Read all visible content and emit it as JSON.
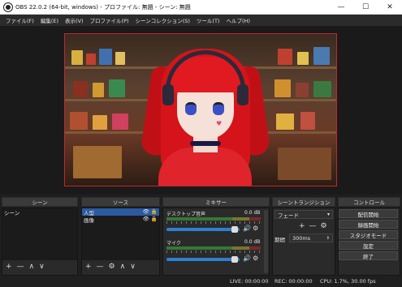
{
  "window": {
    "title": "OBS 22.0.2 (64-bit, windows) - プロファイル: 無題 - シーン: 無題",
    "minimize": "—",
    "maximize": "☐",
    "close": "✕"
  },
  "menu": [
    "ファイル(F)",
    "編集(E)",
    "表示(V)",
    "プロファイル(P)",
    "シーンコレクション(S)",
    "ツール(T)",
    "ヘルプ(H)"
  ],
  "docks": {
    "scenes": {
      "title": "シーン",
      "items": [
        "シーン"
      ],
      "toolbar": [
        "+",
        "—",
        "∧",
        "∨"
      ]
    },
    "sources": {
      "title": "ソース",
      "items": [
        {
          "label": "人型",
          "selected": true
        },
        {
          "label": "画像",
          "selected": false
        }
      ],
      "toolbar": [
        "+",
        "—",
        "⚙",
        "∧",
        "∨"
      ]
    },
    "mixer": {
      "title": "ミキサー",
      "tracks": [
        {
          "name": "デスクトップ音声",
          "db": "0.0 dB",
          "volume": 0.93
        },
        {
          "name": "マイク",
          "db": "0.0 dB",
          "volume": 0.93
        }
      ]
    },
    "transitions": {
      "title": "シーントランジション",
      "selected": "フェード",
      "duration_label": "期間",
      "duration_value": "300ms"
    },
    "controls": {
      "title": "コントロール",
      "buttons": [
        "配信開始",
        "録画開始",
        "スタジオモード",
        "設定",
        "終了"
      ]
    }
  },
  "status": {
    "live": "LIVE: 00:00:00",
    "rec": "REC: 00:00:00",
    "cpu": "CPU: 1.7%, 30.00 fps"
  },
  "icons": {
    "eye": "👁",
    "lock": "🔒",
    "speaker": "🔊",
    "gear": "⚙"
  },
  "colors": {
    "accent": "#2c5aa0",
    "preview_border": "#c0282c",
    "fader": "#2f7fd0"
  }
}
